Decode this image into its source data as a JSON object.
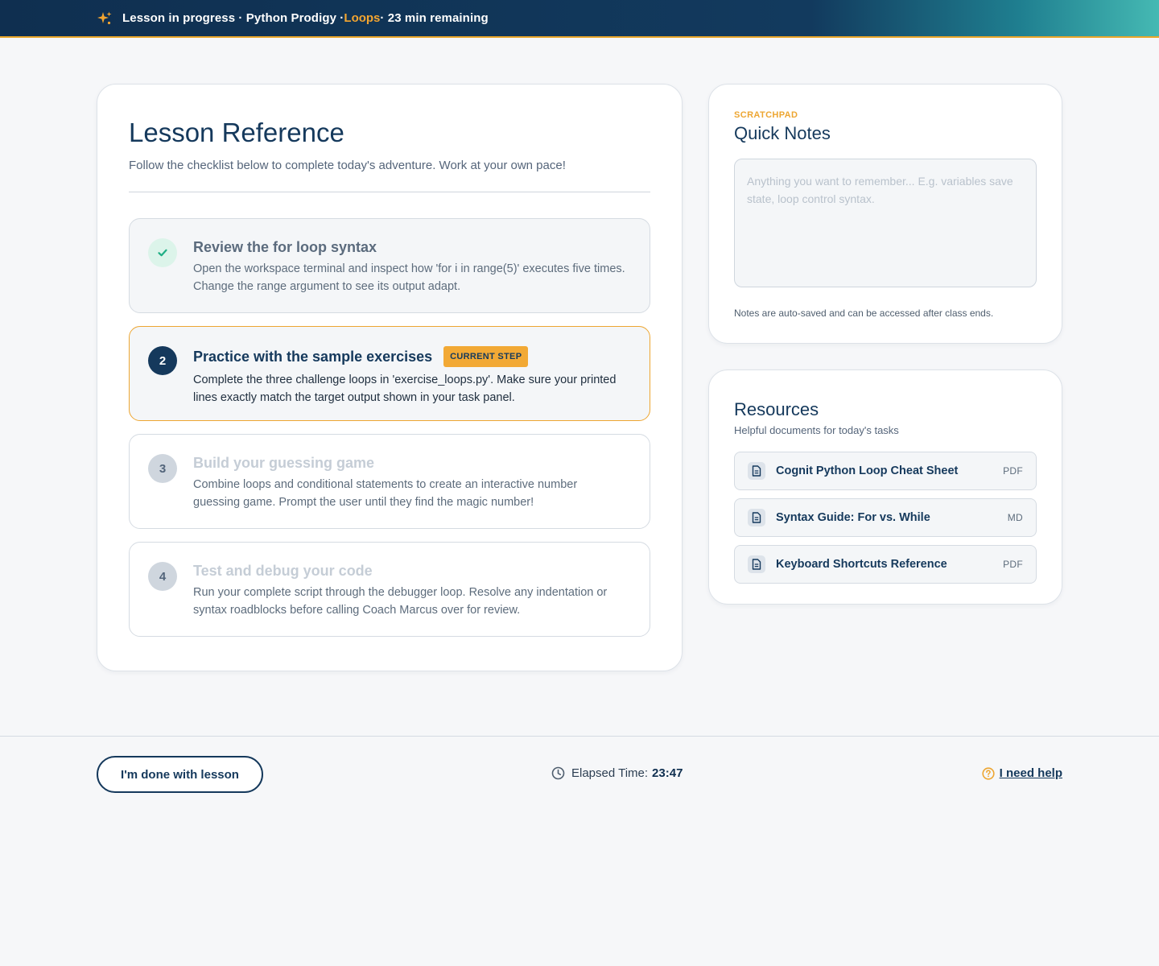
{
  "banner": {
    "status": "Lesson in progress · Python Prodigy · ",
    "topic": "Loops",
    "remaining": " · 23 min remaining",
    "icon": "sparkle-icon"
  },
  "reference": {
    "title": "Lesson Reference",
    "subtitle": "Follow the checklist below to complete today's adventure. Work at your own pace!",
    "steps": [
      {
        "number": "✓",
        "title": "Review the for loop syntax",
        "description": "Open the workspace terminal and inspect how 'for i in range(5)' executes five times. Change the range argument to see its output adapt.",
        "state": "done"
      },
      {
        "number": "2",
        "title": "Practice with the sample exercises",
        "badge": "CURRENT STEP",
        "description": "Complete the three challenge loops in 'exercise_loops.py'. Make sure your printed lines exactly match the target output shown in your task panel.",
        "state": "active"
      },
      {
        "number": "3",
        "title": "Build your guessing game",
        "description": "Combine loops and conditional statements to create an interactive number guessing game. Prompt the user until they find the magic number!",
        "state": "upcoming"
      },
      {
        "number": "4",
        "title": "Test and debug your code",
        "description": "Run your complete script through the debugger loop. Resolve any indentation or syntax roadblocks before calling Coach Marcus over for review.",
        "state": "upcoming"
      }
    ]
  },
  "notes": {
    "eyebrow": "SCRATCHPAD",
    "title": "Quick Notes",
    "value": "",
    "placeholder": "Anything you want to remember... E.g. variables save state, loop control syntax.",
    "hint": "Notes are auto-saved and can be accessed after class ends."
  },
  "resources": {
    "title": "Resources",
    "subtitle": "Helpful documents for today's tasks",
    "items": [
      {
        "name": "Cognit Python Loop Cheat Sheet",
        "type": "PDF",
        "icon": "document-icon"
      },
      {
        "name": "Syntax Guide: For vs. While",
        "type": "MD",
        "icon": "document-icon"
      },
      {
        "name": "Keyboard Shortcuts Reference",
        "type": "PDF",
        "icon": "document-icon"
      }
    ]
  },
  "footer": {
    "done_label": "I'm done with lesson",
    "elapsed_label": "Elapsed Time:",
    "elapsed_value": "23:47",
    "help_label": "I need help"
  },
  "colors": {
    "navy": "#15395c",
    "accent": "#eda632",
    "success": "#1fae84"
  }
}
